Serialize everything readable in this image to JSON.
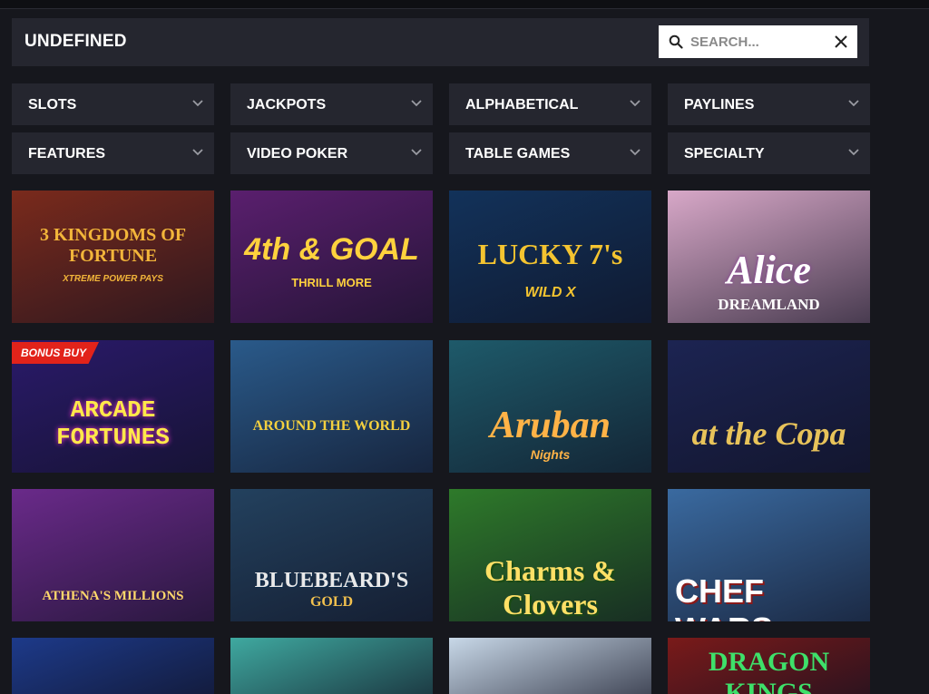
{
  "header": {
    "title": "UNDEFINED"
  },
  "search": {
    "placeholder": "SEARCH..."
  },
  "filters": [
    {
      "label": "SLOTS"
    },
    {
      "label": "JACKPOTS"
    },
    {
      "label": "ALPHABETICAL"
    },
    {
      "label": "PAYLINES"
    },
    {
      "label": "FEATURES"
    },
    {
      "label": "VIDEO POKER"
    },
    {
      "label": "TABLE GAMES"
    },
    {
      "label": "SPECIALTY"
    }
  ],
  "games": [
    {
      "title": "3 KINGDOMS OF FORTUNE",
      "subtitle": "XTREME POWER PAYS",
      "bg": "#7a2a1c",
      "text": "#f2b53a"
    },
    {
      "title": "4th & GOAL",
      "subtitle": "THRILL MORE",
      "bg": "#5a1f6e",
      "text": "#ffd23d"
    },
    {
      "title": "LUCKY 7's",
      "subtitle": "WILD X",
      "bg": "#12325a",
      "text": "#f4c430"
    },
    {
      "title": "Alice",
      "subtitle": "DREAMLAND",
      "bg": "#d8a8c8",
      "text": "#ffffff"
    },
    {
      "title": "ARCADE FORTUNES",
      "subtitle": "",
      "bg": "#2a1a6a",
      "text": "#ffe84a",
      "badge": "BONUS BUY"
    },
    {
      "title": "AROUND THE WORLD",
      "subtitle": "",
      "bg": "#2a5a8a",
      "text": "#f4d03f"
    },
    {
      "title": "Aruban",
      "subtitle": "Nights",
      "bg": "#1e5a6a",
      "text": "#ffb347"
    },
    {
      "title": "at the Copa",
      "subtitle": "",
      "bg": "#1c2452",
      "text": "#e8c35a"
    },
    {
      "title": "ATHENA'S MILLIONS",
      "subtitle": "",
      "bg": "#6a2a8a",
      "text": "#ffd86b"
    },
    {
      "title": "BLUEBEARD'S",
      "subtitle": "GOLD",
      "bg": "#23415e",
      "text": "#e9e9e9"
    },
    {
      "title": "Charms & Clovers",
      "subtitle": "",
      "bg": "#2e7a2a",
      "text": "#ffe066"
    },
    {
      "title": "CHEF WARS",
      "subtitle": "",
      "bg": "#3a6aa0",
      "text": "#ffffff"
    },
    {
      "title": "",
      "subtitle": "",
      "bg": "#1d3a8a",
      "text": "#ffffff"
    },
    {
      "title": "",
      "subtitle": "",
      "bg": "#3fa9a0",
      "text": "#ffffff"
    },
    {
      "title": "",
      "subtitle": "",
      "bg": "#c8d8e8",
      "text": "#ffffff"
    },
    {
      "title": "DRAGON KINGS",
      "subtitle": "",
      "bg": "#7a1a1a",
      "text": "#3ee06a"
    }
  ]
}
